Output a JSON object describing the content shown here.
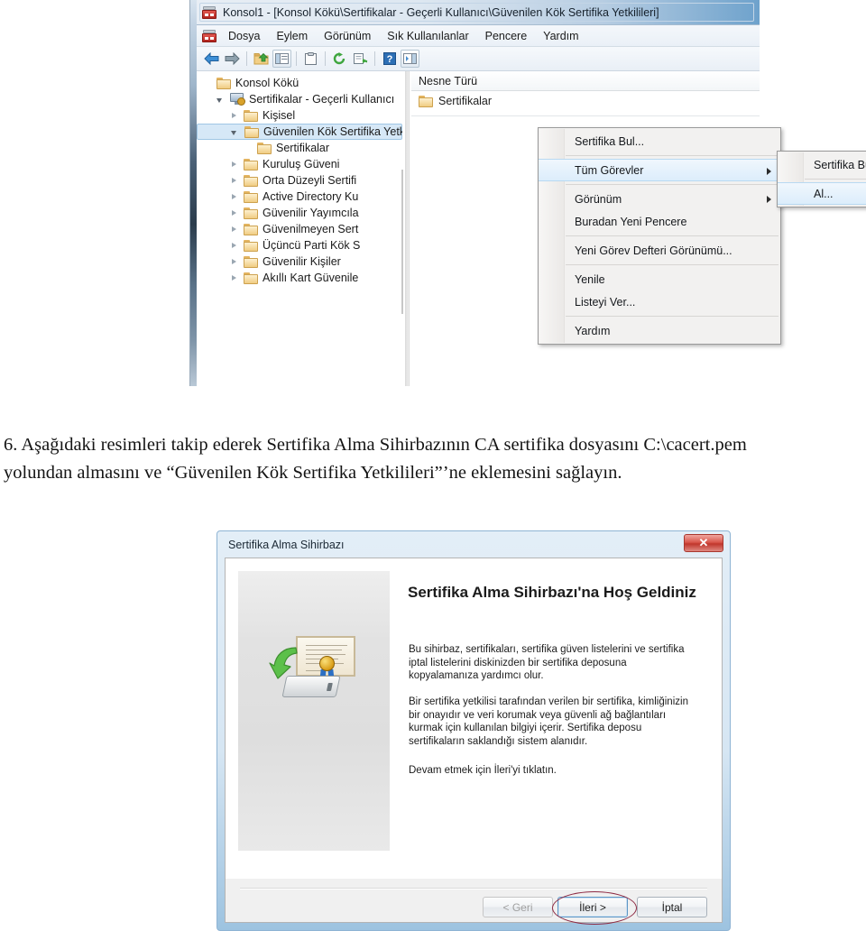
{
  "mmc": {
    "title": "Konsol1 - [Konsol Kökü\\Sertifikalar - Geçerli Kullanıcı\\Güvenilen Kök Sertifika Yetkilileri]",
    "icon": "console-icon",
    "menus": [
      "Dosya",
      "Eylem",
      "Görünüm",
      "Sık Kullanılanlar",
      "Pencere",
      "Yardım"
    ],
    "toolbar_icons": [
      "back-arrow-icon",
      "forward-arrow-icon",
      "up-folder-icon",
      "show-hide-tree-icon",
      "properties-icon",
      "refresh-icon",
      "export-list-icon",
      "help-icon",
      "show-action-pane-icon"
    ],
    "tree": [
      {
        "label": "Konsol Kökü",
        "indent": 0,
        "expander": "none",
        "icon": "folder-icon",
        "selected": false
      },
      {
        "label": "Sertifikalar - Geçerli Kullanıcı",
        "indent": 1,
        "expander": "open",
        "icon": "cert-store-icon",
        "selected": false
      },
      {
        "label": "Kişisel",
        "indent": 2,
        "expander": "closed",
        "icon": "folder-icon",
        "selected": false
      },
      {
        "label": "Güvenilen Kök Sertifika Yetkil",
        "indent": 2,
        "expander": "open",
        "icon": "folder-icon",
        "selected": true
      },
      {
        "label": "Sertifikalar",
        "indent": 3,
        "expander": "none",
        "icon": "folder-icon",
        "selected": false
      },
      {
        "label": "Kuruluş Güveni",
        "indent": 2,
        "expander": "closed",
        "icon": "folder-icon",
        "selected": false
      },
      {
        "label": "Orta Düzeyli Sertifi",
        "indent": 2,
        "expander": "closed",
        "icon": "folder-icon",
        "selected": false
      },
      {
        "label": "Active Directory Ku",
        "indent": 2,
        "expander": "closed",
        "icon": "folder-icon",
        "selected": false
      },
      {
        "label": "Güvenilir Yayımcıla",
        "indent": 2,
        "expander": "closed",
        "icon": "folder-icon",
        "selected": false
      },
      {
        "label": "Güvenilmeyen Sert",
        "indent": 2,
        "expander": "closed",
        "icon": "folder-icon",
        "selected": false
      },
      {
        "label": "Üçüncü Parti Kök S",
        "indent": 2,
        "expander": "closed",
        "icon": "folder-icon",
        "selected": false
      },
      {
        "label": "Güvenilir Kişiler",
        "indent": 2,
        "expander": "closed",
        "icon": "folder-icon",
        "selected": false
      },
      {
        "label": "Akıllı Kart Güvenile",
        "indent": 2,
        "expander": "closed",
        "icon": "folder-icon",
        "selected": false
      }
    ],
    "list": {
      "header": "Nesne Türü",
      "rows": [
        "Sertifikalar"
      ]
    },
    "context_menu": {
      "items": [
        {
          "label": "Sertifika Bul...",
          "submenu": false,
          "highlight": false,
          "sep_after": true
        },
        {
          "label": "Tüm Görevler",
          "submenu": true,
          "highlight": true,
          "sep_after": true
        },
        {
          "label": "Görünüm",
          "submenu": true,
          "highlight": false,
          "sep_after": false
        },
        {
          "label": "Buradan Yeni Pencere",
          "submenu": false,
          "highlight": false,
          "sep_after": true
        },
        {
          "label": "Yeni Görev Defteri Görünümü...",
          "submenu": false,
          "highlight": false,
          "sep_after": true
        },
        {
          "label": "Yenile",
          "submenu": false,
          "highlight": false,
          "sep_after": false
        },
        {
          "label": "Listeyi Ver...",
          "submenu": false,
          "highlight": false,
          "sep_after": true
        },
        {
          "label": "Yardım",
          "submenu": false,
          "highlight": false,
          "sep_after": false
        }
      ],
      "submenu": {
        "items": [
          {
            "label": "Sertifika Bul...",
            "highlight": false,
            "sep_after": true
          },
          {
            "label": "Al...",
            "highlight": true,
            "sep_after": false
          }
        ]
      }
    }
  },
  "paragraph": {
    "line1": "6. Aşağıdaki resimleri takip ederek Sertifika Alma Sihirbazının CA sertifika dosyasını C:\\cacert.pem",
    "line2": "yolundan almasını ve “Güvenilen Kök Sertifika Yetkilileri”’ne eklemesini sağlayın."
  },
  "wizard": {
    "title": "Sertifika Alma Sihirbazı",
    "close_label": "✕",
    "close_icon": "close-icon",
    "art_icon": "certificate-import-icon",
    "heading": "Sertifika Alma Sihirbazı'na Hoş Geldiniz",
    "paragraph1": "Bu sihirbaz, sertifikaları, sertifika güven listelerini ve sertifika iptal listelerini diskinizden bir sertifika deposuna kopyalamanıza yardımcı olur.",
    "paragraph2": "Bir sertifika yetkilisi tarafından verilen bir sertifika, kimliğinizin bir onayıdır ve veri korumak veya güvenli ağ bağlantıları kurmak için kullanılan bilgiyi içerir. Sertifika deposu sertifikaların saklandığı sistem alanıdır.",
    "paragraph3": "Devam etmek için İleri'yi tıklatın.",
    "buttons": {
      "back": "< Geri",
      "next": "İleri >",
      "cancel": "İptal"
    },
    "annotation": "red-ellipse-highlight-on-next-button"
  },
  "colors": {
    "title_accent": "#6ea2cc",
    "selection": "#d6e8f7",
    "menu_highlight": "#dcedfb",
    "annotation_red": "#8e2b44",
    "close_red": "#c0362c"
  }
}
